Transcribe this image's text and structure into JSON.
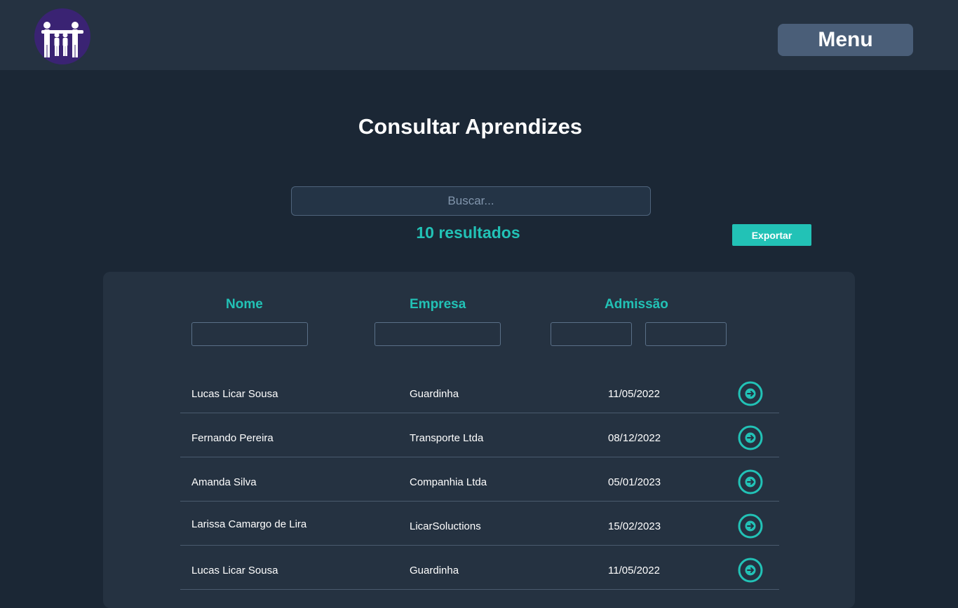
{
  "header": {
    "logo_icon": "family-people-icon",
    "menu_label": "Menu"
  },
  "page": {
    "title": "Consultar Aprendizes"
  },
  "search": {
    "placeholder": "Buscar...",
    "value": ""
  },
  "results": {
    "count_label": "10 resultados",
    "export_label": "Exportar"
  },
  "table": {
    "columns": [
      {
        "label": "Nome"
      },
      {
        "label": "Empresa"
      },
      {
        "label": "Admissão"
      }
    ],
    "filters": {
      "nome": "",
      "empresa": "",
      "admissao_de": "",
      "admissao_ate": ""
    },
    "row_action_icon": "arrow-right-circle-icon",
    "rows": [
      {
        "nome": "Lucas Licar Sousa",
        "empresa": "Guardinha",
        "admissao": "11/05/2022"
      },
      {
        "nome": "Fernando Pereira",
        "empresa": "Transporte Ltda",
        "admissao": "08/12/2022"
      },
      {
        "nome": "Amanda Silva",
        "empresa": "Companhia Ltda",
        "admissao": "05/01/2023"
      },
      {
        "nome": "Larissa Camargo de Lira",
        "empresa": "LicarSoluctions",
        "admissao": "15/02/2023"
      },
      {
        "nome": "Lucas Licar Sousa",
        "empresa": "Guardinha",
        "admissao": "11/05/2022"
      }
    ]
  },
  "colors": {
    "accent": "#22c2b6",
    "background": "#1b2735",
    "panel": "#253241",
    "menu_button": "#4a5e78",
    "logo": "#3a2373"
  }
}
